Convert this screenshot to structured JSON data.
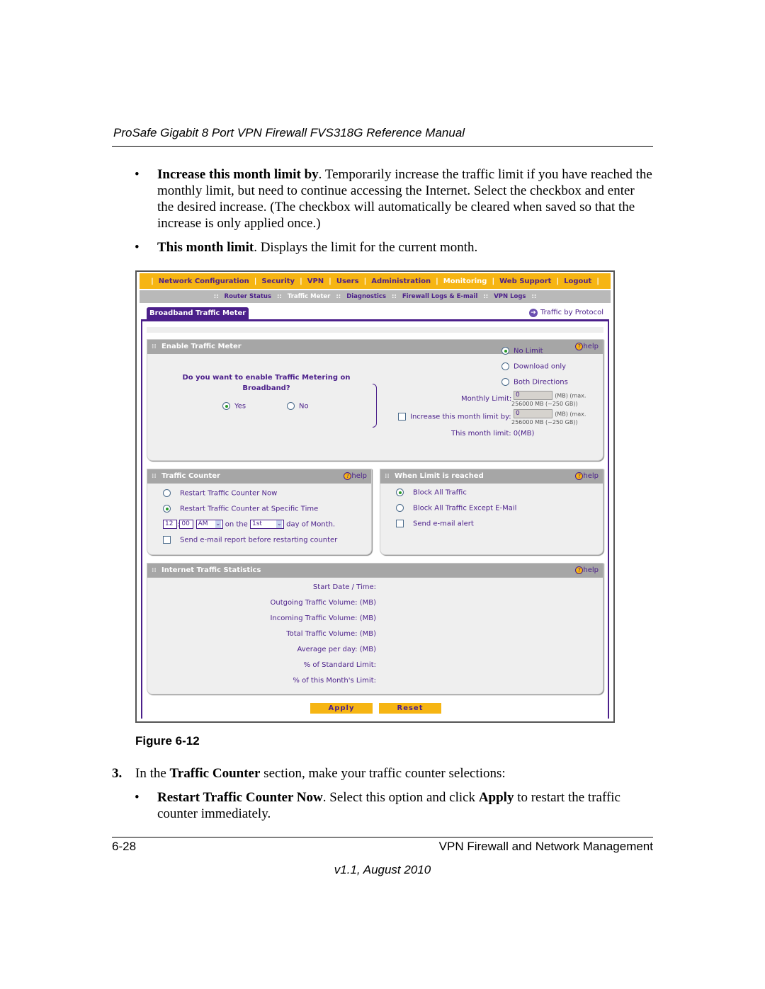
{
  "header": {
    "title": "ProSafe Gigabit 8 Port VPN Firewall FVS318G Reference Manual"
  },
  "bullets_top": [
    {
      "bold": "Increase this month limit by",
      "text": ". Temporarily increase the traffic limit if you have reached the monthly limit, but need to continue accessing the Internet. Select the checkbox and enter the desired increase. (The checkbox will automatically be cleared when saved so that the increase is only applied once.)"
    },
    {
      "bold": "This month limit",
      "text": ". Displays the limit for the current month."
    }
  ],
  "ui": {
    "nav": [
      "Network Configuration",
      "Security",
      "VPN",
      "Users",
      "Administration",
      "Monitoring",
      "Web Support",
      "Logout"
    ],
    "subnav": [
      "Router Status",
      "Traffic Meter",
      "Diagnostics",
      "Firewall Logs & E-mail",
      "VPN Logs"
    ],
    "tab": "Broadband Traffic Meter",
    "traffic_by_protocol": "Traffic by Protocol",
    "help": "help",
    "enable": {
      "title": "Enable Traffic Meter",
      "question1": "Do you want to enable Traffic Metering on",
      "question2": "Broadband?",
      "yes": "Yes",
      "no": "No",
      "no_limit": "No Limit",
      "download_only": "Download only",
      "both_directions": "Both Directions",
      "monthly_limit_label": "Monthly Limit:",
      "monthly_limit_value": "0",
      "unit_note1": "(MB) (max.",
      "unit_note2": "256000 MB (~250 GB))",
      "increase_label": "Increase this month limit by:",
      "increase_value": "0",
      "this_month": "This month limit: 0(MB)"
    },
    "counter": {
      "title": "Traffic Counter",
      "now": "Restart Traffic Counter Now",
      "specific": "Restart Traffic Counter at Specific Time",
      "hour": "12",
      "minute": "00",
      "ampm": "AM",
      "on_the": "on the",
      "day": "1st",
      "day_of_month": "day of Month.",
      "email_report": "Send e-mail report before restarting counter"
    },
    "limit": {
      "title": "When Limit is reached",
      "block_all": "Block All Traffic",
      "block_except": "Block All Traffic Except E-Mail",
      "send_alert": "Send e-mail alert"
    },
    "stats": {
      "title": "Internet Traffic Statistics",
      "rows": [
        "Start Date / Time:",
        "Outgoing Traffic Volume: (MB)",
        "Incoming Traffic Volume: (MB)",
        "Total Traffic Volume: (MB)",
        "Average per day: (MB)",
        "% of Standard Limit:",
        "% of this Month's Limit:"
      ]
    },
    "apply": "Apply",
    "reset": "Reset"
  },
  "figure_caption": "Figure 6-12",
  "step": {
    "num": "3.",
    "pre": "In the ",
    "bold": "Traffic Counter",
    "post": " section, make your traffic counter selections:"
  },
  "bullet_bottom": {
    "bold": "Restart Traffic Counter Now",
    "t1": ". Select this option and click ",
    "bold2": "Apply",
    "t2": " to restart the traffic counter immediately."
  },
  "footer": {
    "page": "6-28",
    "chapter": "VPN Firewall and Network Management",
    "version": "v1.1, August 2010"
  }
}
